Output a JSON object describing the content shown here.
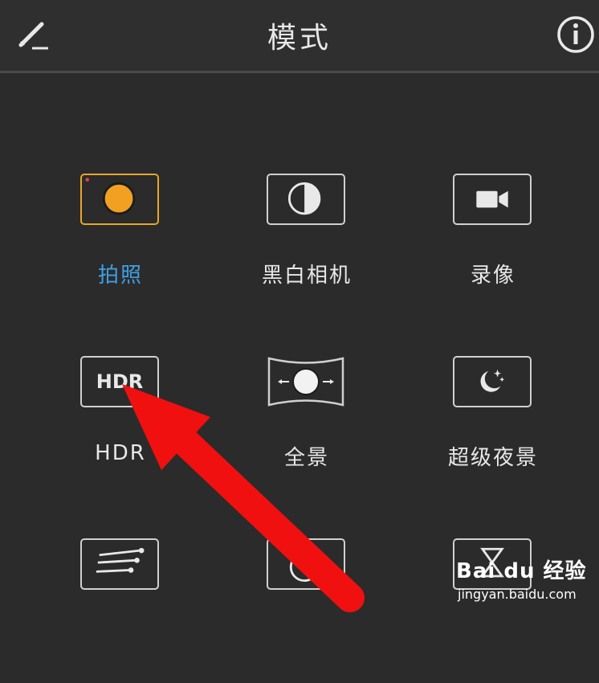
{
  "header": {
    "title": "模式",
    "edit_icon": "pencil-icon",
    "info_icon": "info-icon"
  },
  "modes": [
    {
      "label": "拍照",
      "icon": "shutter-icon",
      "active": true
    },
    {
      "label": "黑白相机",
      "icon": "half-circle-icon",
      "active": false
    },
    {
      "label": "录像",
      "icon": "video-camera-icon",
      "active": false
    },
    {
      "label": "HDR",
      "icon": "hdr-icon",
      "icon_text": "HDR",
      "active": false
    },
    {
      "label": "全景",
      "icon": "panorama-icon",
      "active": false
    },
    {
      "label": "超级夜景",
      "icon": "moon-stars-icon",
      "active": false
    },
    {
      "label": "",
      "icon": "light-trails-icon",
      "active": false
    },
    {
      "label": "",
      "icon": "circle-icon",
      "active": false
    },
    {
      "label": "",
      "icon": "hourglass-icon",
      "active": false
    }
  ],
  "watermark": {
    "line1": "Bai du 经验",
    "line2": "jingyan.baidu.com"
  },
  "colors": {
    "background": "#2b2b2b",
    "active_label": "#3ea0e6",
    "active_border": "#e8a52a",
    "shutter": "#f2a022",
    "arrow": "#f01010"
  }
}
